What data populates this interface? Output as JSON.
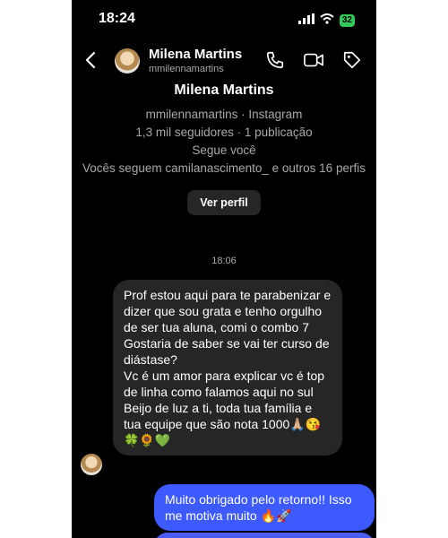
{
  "status": {
    "time": "18:24",
    "battery": "32"
  },
  "header": {
    "name": "Milena Martins",
    "username": "mmilennamartins"
  },
  "profile": {
    "name": "Milena Martins",
    "handle_line": "mmilennamartins · Instagram",
    "stats_line": "1,3 mil seguidores · 1 publicação",
    "follows_line": "Segue você",
    "mutual_line": "Vocês seguem camilanascimento_ e outros 16 perfis",
    "view_profile_label": "Ver perfil"
  },
  "thread": {
    "timestamp": "18:06",
    "incoming": {
      "p1": "Prof estou aqui para te parabenizar e dizer que sou grata e tenho orgulho de ser tua aluna, comi o combo 7",
      "p2": "Gostaria de saber se vai ter curso de diástase?",
      "p3": "Vc é um amor para explicar vc é top de linha como falamos aqui no sul",
      "p4": "Beijo de luz a ti, toda tua família e tua equipe que são nota 1000🙏🏼😘🍀🌻💚"
    },
    "outgoing": {
      "text": "Muito obrigado pelo retorno!! Isso me motiva muito 🔥🚀"
    }
  },
  "colors": {
    "background": "#000000",
    "incoming_bubble": "#262626",
    "outgoing_bubble": "#3d5afe",
    "secondary_text": "#a8a8a8"
  },
  "icons": {
    "back": "chevron-left-icon",
    "call": "phone-icon",
    "video": "video-icon",
    "tag": "tag-icon",
    "signal": "signal-icon",
    "wifi": "wifi-icon"
  }
}
